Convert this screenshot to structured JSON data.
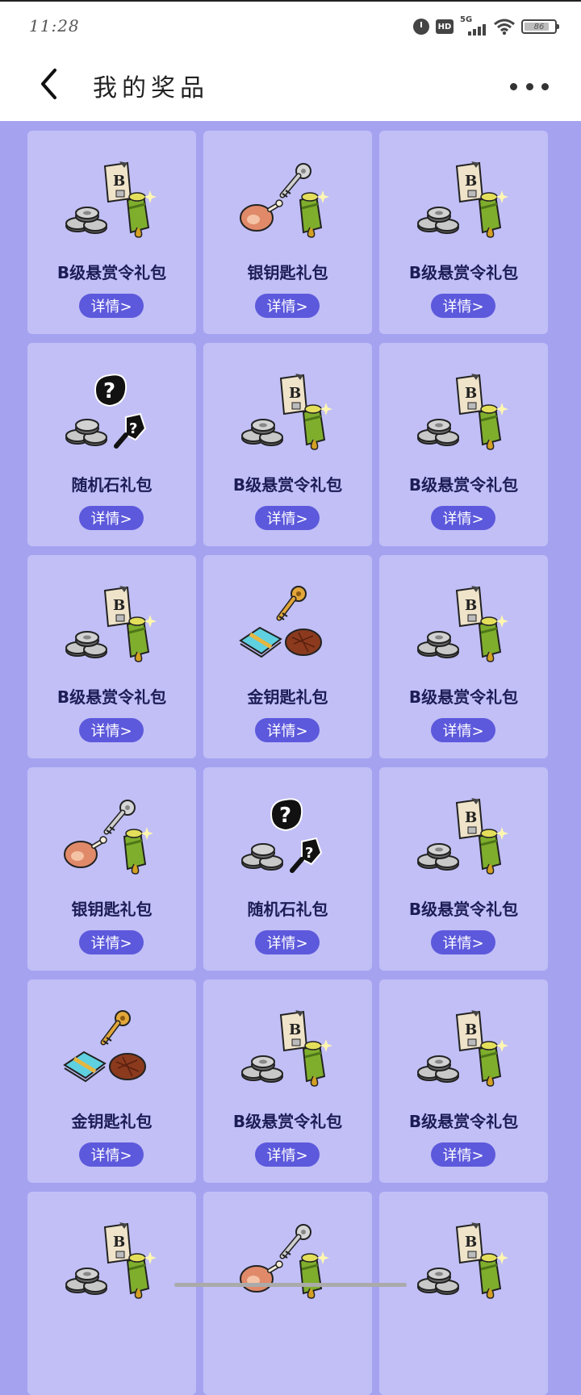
{
  "status": {
    "time": "11:28",
    "network": "5G",
    "hd": "HD",
    "battery_level": "86",
    "battery_fraction": 0.86
  },
  "header": {
    "title": "我的奖品",
    "back_icon": "chevron-left-icon",
    "more_icon": "more-horizontal-icon"
  },
  "colors": {
    "page_bg": "#a5a3f0",
    "card_bg": "#c1bff6",
    "button_bg": "#5d59dc",
    "title_text": "#1d1d55"
  },
  "prizes": [
    {
      "name": "B级悬赏令礼包",
      "detail_label": "详情>",
      "art": "bounty"
    },
    {
      "name": "银钥匙礼包",
      "detail_label": "详情>",
      "art": "silver"
    },
    {
      "name": "B级悬赏令礼包",
      "detail_label": "详情>",
      "art": "bounty"
    },
    {
      "name": "随机石礼包",
      "detail_label": "详情>",
      "art": "random"
    },
    {
      "name": "B级悬赏令礼包",
      "detail_label": "详情>",
      "art": "bounty"
    },
    {
      "name": "B级悬赏令礼包",
      "detail_label": "详情>",
      "art": "bounty"
    },
    {
      "name": "B级悬赏令礼包",
      "detail_label": "详情>",
      "art": "bounty"
    },
    {
      "name": "金钥匙礼包",
      "detail_label": "详情>",
      "art": "gold"
    },
    {
      "name": "B级悬赏令礼包",
      "detail_label": "详情>",
      "art": "bounty"
    },
    {
      "name": "银钥匙礼包",
      "detail_label": "详情>",
      "art": "silver"
    },
    {
      "name": "随机石礼包",
      "detail_label": "详情>",
      "art": "random"
    },
    {
      "name": "B级悬赏令礼包",
      "detail_label": "详情>",
      "art": "bounty"
    },
    {
      "name": "金钥匙礼包",
      "detail_label": "详情>",
      "art": "gold"
    },
    {
      "name": "B级悬赏令礼包",
      "detail_label": "详情>",
      "art": "bounty"
    },
    {
      "name": "B级悬赏令礼包",
      "detail_label": "详情>",
      "art": "bounty"
    },
    {
      "name": "",
      "detail_label": "",
      "art": "bounty"
    },
    {
      "name": "",
      "detail_label": "",
      "art": "silver"
    },
    {
      "name": "",
      "detail_label": "",
      "art": "bounty"
    }
  ]
}
